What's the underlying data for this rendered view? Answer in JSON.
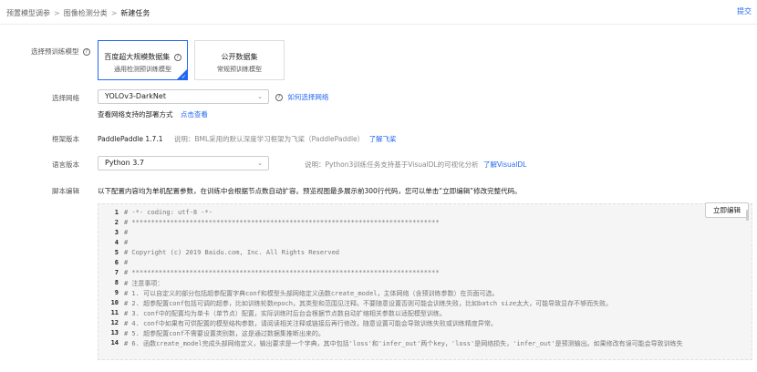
{
  "breadcrumb": [
    "预置模型调参",
    "图像检测分类",
    "新建任务"
  ],
  "header": {
    "submit_link": "提交"
  },
  "form": {
    "pretrain_label": "选择预训练模型",
    "pretrain_options": [
      {
        "title": "百度超大规模数据集",
        "sub": "通用检测预训练模型",
        "selected": true
      },
      {
        "title": "公开数据集",
        "sub": "常规预训练模型",
        "selected": false
      }
    ],
    "network_label": "选择网络",
    "network_value": "YOLOv3-DarkNet",
    "network_help": "如何选择网络",
    "deploy_text": "查看网络支持的部署方式",
    "deploy_link": "点击查看",
    "framework_label": "框架版本",
    "framework_value": "PaddlePaddle 1.7.1",
    "framework_desc": "说明：BML采用的默认深度学习框架为飞桨（PaddlePaddle）",
    "framework_link": "了解飞桨",
    "language_label": "语言版本",
    "language_value": "Python 3.7",
    "language_desc": "说明：Python3训练任务支持基于VisualDL的可视化分析",
    "language_link": "了解VisualDL",
    "script_label": "脚本编辑",
    "script_desc": "以下配置内容均为单机配置参数，在训练中会根据节点数自动扩容。预览视图最多展示前300行代码，您可以单击“立即编辑”修改完整代码。",
    "edit_button": "立即编辑"
  },
  "code_lines": [
    {
      "n": "1",
      "text": "# -*- coding: utf-8 -*-"
    },
    {
      "n": "2",
      "text": "# ********************************************************************************"
    },
    {
      "n": "3",
      "text": "#"
    },
    {
      "n": "4",
      "text": "#"
    },
    {
      "n": "5",
      "text": "# Copyright (c) 2019 Baidu.com, Inc. All Rights Reserved"
    },
    {
      "n": "6",
      "text": "#"
    },
    {
      "n": "7",
      "text": "# ********************************************************************************"
    },
    {
      "n": "8",
      "text": "# 注意事项："
    },
    {
      "n": "9",
      "text": "# 1. 可以自定义的部分包括超参配置字典conf和模型头部网络定义函数create_model，主体网络（含预训练参数）在页面可选。"
    },
    {
      "n": "10",
      "text": "# 2. 超参配置conf包括可调的超参，比如训练轮数epoch，其类型和范围见注释。不要随意设置否则可能会训练失败，比如batch size太大，可能导致显存不够而失败。"
    },
    {
      "n": "11",
      "text": "# 3. conf中的配置均为单卡（单节点）配置，实际训练时后台会根据节点数自动扩缩相关参数以适配模型训练。"
    },
    {
      "n": "12",
      "text": "# 4. conf中如果有可供配置的模型结构参数，请阅读相关注释或链接后再行修改，随意设置可能会导致训练失败或训练精度异常。"
    },
    {
      "n": "13",
      "text": "# 5. 超参配置conf不需要设置类别数，这是通过数据集推断出来的。"
    },
    {
      "n": "14",
      "text": "# 6. 函数create_model完成头部网络定义，输出要求是一个字典，其中包括'loss'和'infer_out'两个key，'loss'是网络损失，'infer_out'是预测输出。如果修改有误可能会导致训练失"
    }
  ]
}
